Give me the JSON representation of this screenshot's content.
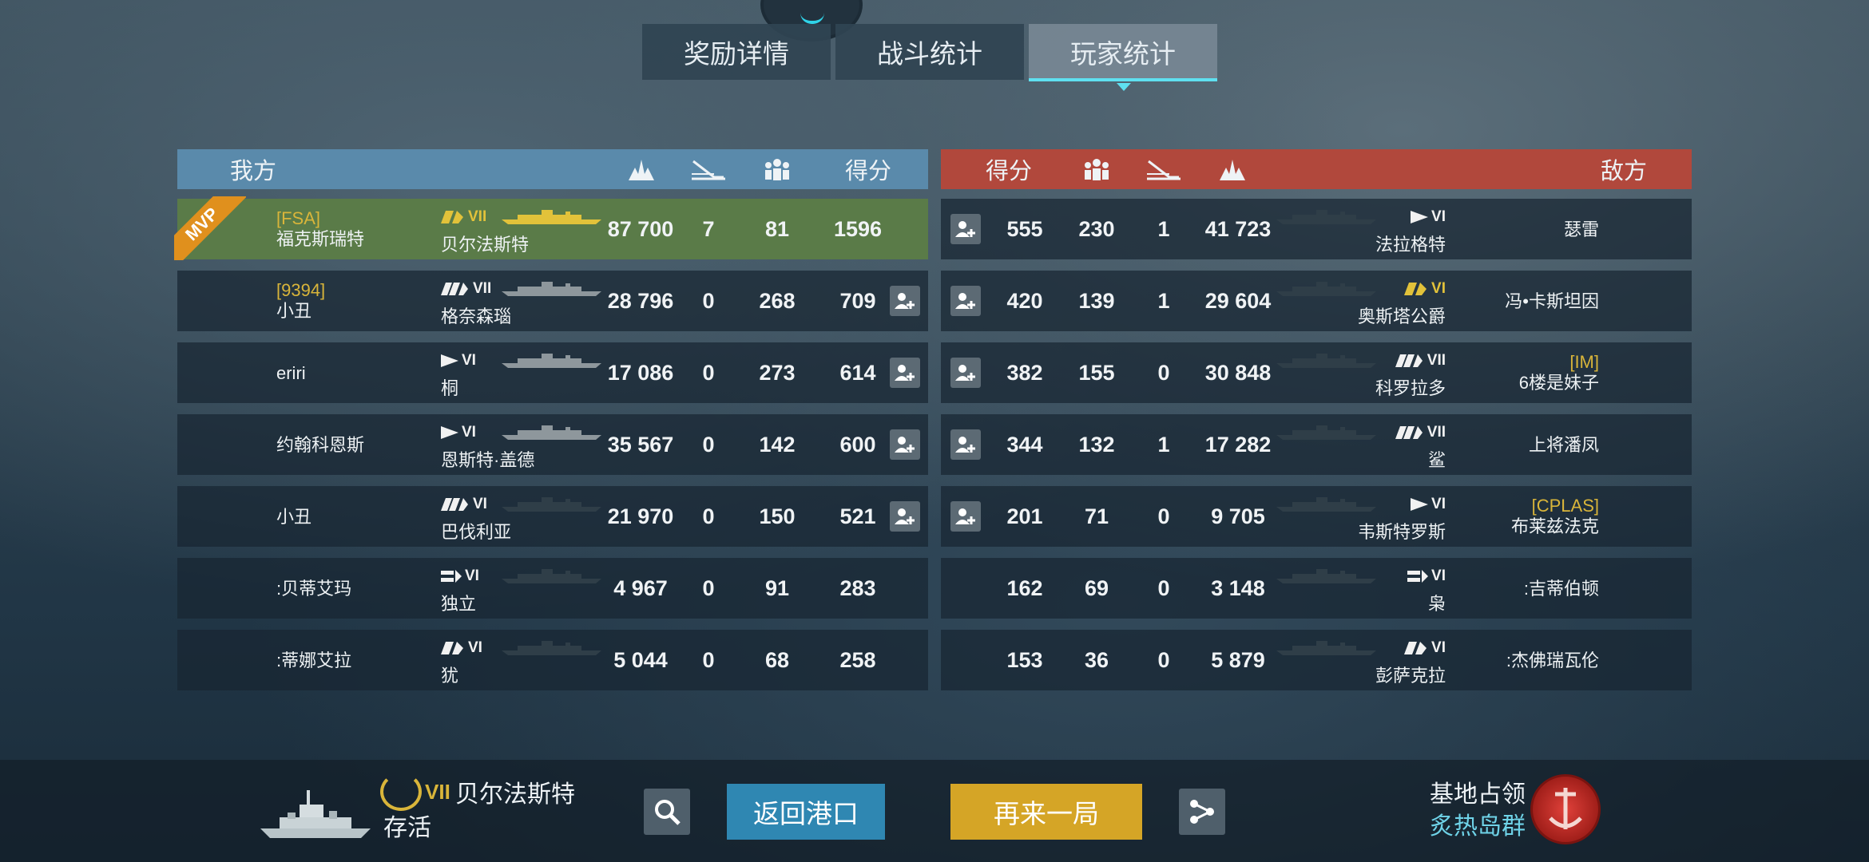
{
  "tabs": [
    "奖励详情",
    "战斗统计",
    "玩家统计"
  ],
  "headers": {
    "ally": "我方",
    "enemy": "敌方",
    "score": "得分"
  },
  "ally_rows": [
    {
      "clan": "[FSA]",
      "player": "福克斯瑞特",
      "ship": "贝尔法斯特",
      "tier": "VII",
      "cls": "cruiser",
      "gold": true,
      "damage": "87 700",
      "kills": "7",
      "spotted": "81",
      "score": "1596",
      "add": false,
      "mvp": true
    },
    {
      "clan": "[9394]",
      "player": "小丑",
      "ship": "格奈森瑙",
      "tier": "VII",
      "cls": "battleship",
      "gold": false,
      "damage": "28 796",
      "kills": "0",
      "spotted": "268",
      "score": "709",
      "add": true
    },
    {
      "clan": "",
      "player": "eriri",
      "ship": "桐",
      "tier": "VI",
      "cls": "destroyer",
      "gold": false,
      "damage": "17 086",
      "kills": "0",
      "spotted": "273",
      "score": "614",
      "add": true
    },
    {
      "clan": "",
      "player": "约翰科恩斯",
      "ship": "恩斯特·盖德",
      "tier": "VI",
      "cls": "destroyer",
      "gold": false,
      "damage": "35 567",
      "kills": "0",
      "spotted": "142",
      "score": "600",
      "add": true
    },
    {
      "clan": "",
      "player": "小丑",
      "ship": "巴伐利亚",
      "tier": "VI",
      "cls": "battleship",
      "gold": false,
      "damage": "21 970",
      "kills": "0",
      "spotted": "150",
      "score": "521",
      "add": true
    },
    {
      "clan": "",
      "player": ":贝蒂艾玛",
      "ship": "独立",
      "tier": "VI",
      "cls": "carrier",
      "gold": false,
      "damage": "4 967",
      "kills": "0",
      "spotted": "91",
      "score": "283",
      "add": false
    },
    {
      "clan": "",
      "player": ":蒂娜艾拉",
      "ship": "犹",
      "tier": "VI",
      "cls": "cruiser",
      "gold": false,
      "damage": "5 044",
      "kills": "0",
      "spotted": "68",
      "score": "258",
      "add": false
    }
  ],
  "enemy_rows": [
    {
      "clan": "",
      "player": "瑟雷",
      "ship": "法拉格特",
      "tier": "VI",
      "cls": "destroyer",
      "gold": false,
      "damage": "41 723",
      "kills": "1",
      "spotted": "230",
      "score": "555",
      "add": true
    },
    {
      "clan": "",
      "player": "冯•卡斯坦因",
      "ship": "奥斯塔公爵",
      "tier": "VI",
      "cls": "cruiser",
      "gold": true,
      "damage": "29 604",
      "kills": "1",
      "spotted": "139",
      "score": "420",
      "add": true
    },
    {
      "clan": "[IM]",
      "player": "6楼是妹子",
      "ship": "科罗拉多",
      "tier": "VII",
      "cls": "battleship",
      "gold": false,
      "damage": "30 848",
      "kills": "0",
      "spotted": "155",
      "score": "382",
      "add": true
    },
    {
      "clan": "",
      "player": "上将潘凤",
      "ship": "鲨",
      "tier": "VII",
      "cls": "battleship",
      "gold": false,
      "damage": "17 282",
      "kills": "1",
      "spotted": "132",
      "score": "344",
      "add": true
    },
    {
      "clan": "[CPLAS]",
      "player": "布莱兹法克",
      "ship": "韦斯特罗斯",
      "tier": "VI",
      "cls": "destroyer",
      "gold": false,
      "damage": "9 705",
      "kills": "0",
      "spotted": "71",
      "score": "201",
      "add": true
    },
    {
      "clan": "",
      "player": ":吉蒂伯顿",
      "ship": "枭",
      "tier": "VI",
      "cls": "carrier",
      "gold": false,
      "damage": "3 148",
      "kills": "0",
      "spotted": "69",
      "score": "162",
      "add": false
    },
    {
      "clan": "",
      "player": ":杰佛瑞瓦伦",
      "ship": "彭萨克拉",
      "tier": "VI",
      "cls": "cruiser",
      "gold": false,
      "damage": "5 879",
      "kills": "0",
      "spotted": "36",
      "score": "153",
      "add": false
    }
  ],
  "bottom": {
    "ship_tier": "VII",
    "ship_name": "贝尔法斯特",
    "status": "存活",
    "btn_port": "返回港口",
    "btn_again": "再来一局",
    "mode": "基地占领",
    "map": "炙热岛群",
    "mvp": "MVP"
  },
  "colors": {
    "ally_header": "#5a8aab",
    "enemy_header": "#b1483c",
    "mvp_row": "#5a7b48",
    "btn_port": "#2f87b2",
    "btn_again": "#d5a526",
    "clan": "#d9b53a",
    "tab_accent": "#5fe0f0"
  }
}
